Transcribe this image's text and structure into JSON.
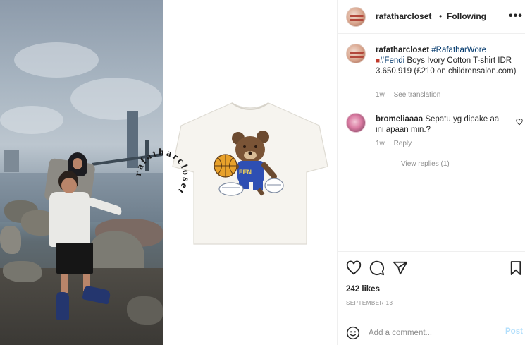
{
  "header": {
    "username": "rafatharcloset",
    "separator": "•",
    "follow_status": "Following",
    "more_label": "•••"
  },
  "caption": {
    "username": "rafatharcloset",
    "hashtag_1": "#RafatharWore",
    "hashtag_2": "#Fendi",
    "text": " Boys Ivory Cotton T-shirt IDR 3.650.919 (£210 on childrensalon.com)",
    "time": "1w",
    "see_translation": "See translation"
  },
  "comments": [
    {
      "username": "bromeliaaaa",
      "text": "Sepatu yg dipake aa ini apaan min.?",
      "time": "1w",
      "reply_label": "Reply",
      "view_replies": "View replies (1)"
    }
  ],
  "stats": {
    "likes": "242 likes",
    "date": "SEPTEMBER 13"
  },
  "comment_input": {
    "placeholder": "Add a comment...",
    "post_label": "Post"
  },
  "watermark": {
    "text": "rafatharcloset"
  },
  "icons": {
    "like": "heart-icon",
    "comment": "comment-icon",
    "share": "paper-plane-icon",
    "save": "bookmark-icon",
    "emoji": "emoji-icon",
    "more": "more-options-icon"
  },
  "colors": {
    "text": "#262626",
    "secondary": "#8e8e8e",
    "link": "#00376b",
    "post_disabled": "#b2dffc",
    "border": "#efefef"
  }
}
